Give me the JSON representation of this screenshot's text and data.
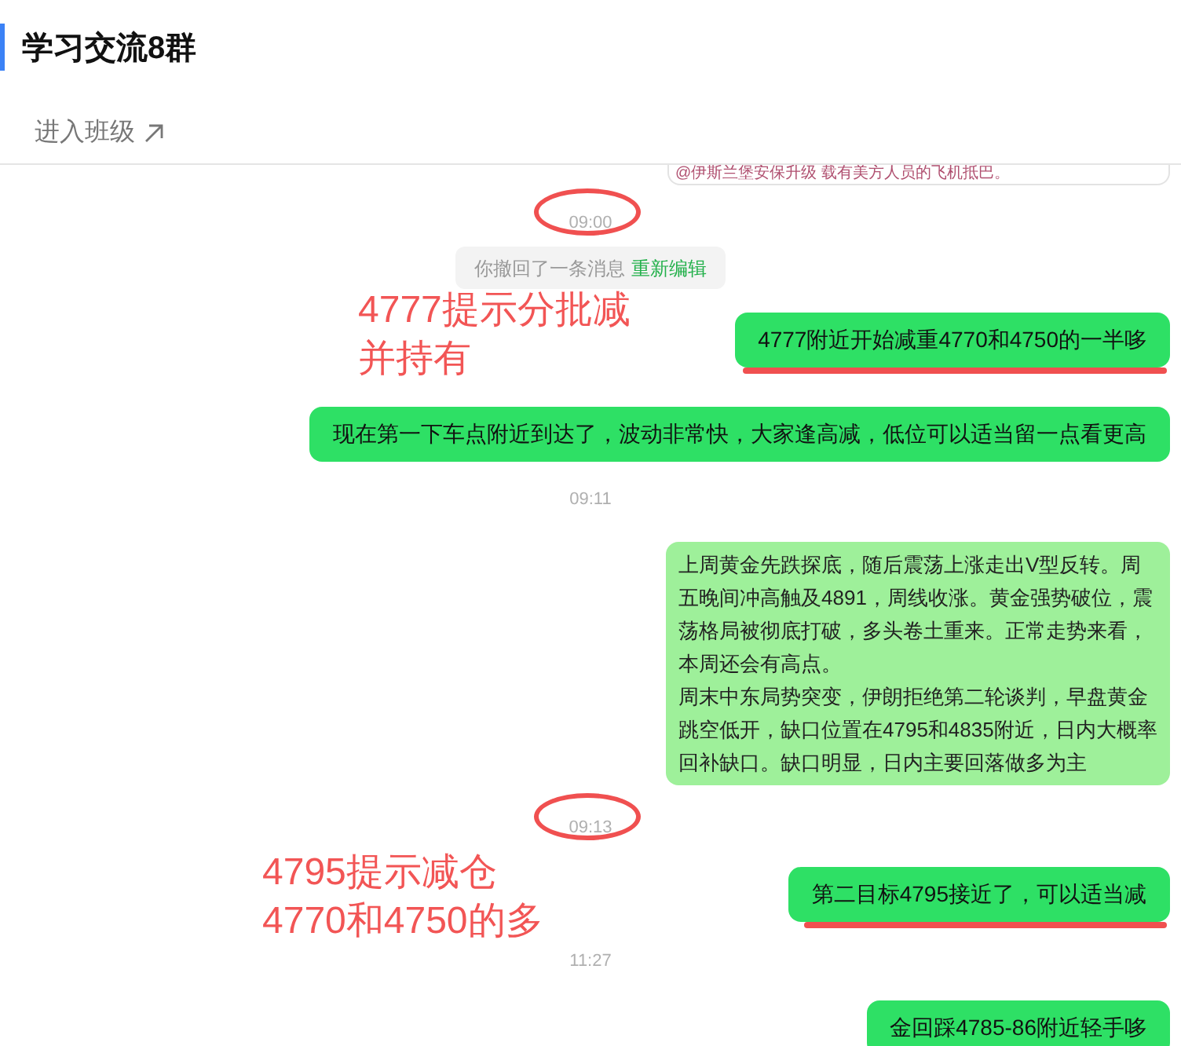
{
  "header": {
    "title": "学习交流8群",
    "link": "进入班级"
  },
  "clipped_card": {
    "text": "@伊斯兰堡安保升级 载有美方人员的飞机抵巴。"
  },
  "messages": [
    {
      "kind": "time",
      "text": "09:00",
      "circled": true
    },
    {
      "kind": "system",
      "text": "你撤回了一条消息",
      "action": "重新编辑"
    },
    {
      "kind": "text",
      "text": "4777附近开始减重4770和4750的一半哆",
      "underlined": true
    },
    {
      "kind": "text",
      "text": "现在第一下车点附近到达了，波动非常快，大家逢高减，低位可以适当留一点看更高",
      "underlined": false
    },
    {
      "kind": "time",
      "text": "09:11",
      "circled": false
    },
    {
      "kind": "image_text",
      "lines": [
        "上周黄金先跌探底，随后震荡上涨走出V型反转。周五晚间冲高触及4891，周线收涨。黄金强势破位，震荡格局被彻底打破，多头卷土重来。正常走势来看，本周还会有高点。",
        "周末中东局势突变，伊朗拒绝第二轮谈判，早盘黄金跳空低开，缺口位置在4795和4835附近，日内大概率回补缺口。缺口明显，日内主要回落做多为主"
      ]
    },
    {
      "kind": "time",
      "text": "09:13",
      "circled": true
    },
    {
      "kind": "text",
      "text": "第二目标4795接近了，可以适当减",
      "underlined": true
    },
    {
      "kind": "time",
      "text": "11:27",
      "circled": false
    },
    {
      "kind": "text",
      "text": "金回踩4785-86附近轻手哆",
      "underlined": false
    }
  ],
  "annotations": [
    {
      "lines": [
        "4777提示分批减",
        "并持有"
      ]
    },
    {
      "lines": [
        "4795提示减仓",
        "4770和4750的多"
      ]
    }
  ]
}
